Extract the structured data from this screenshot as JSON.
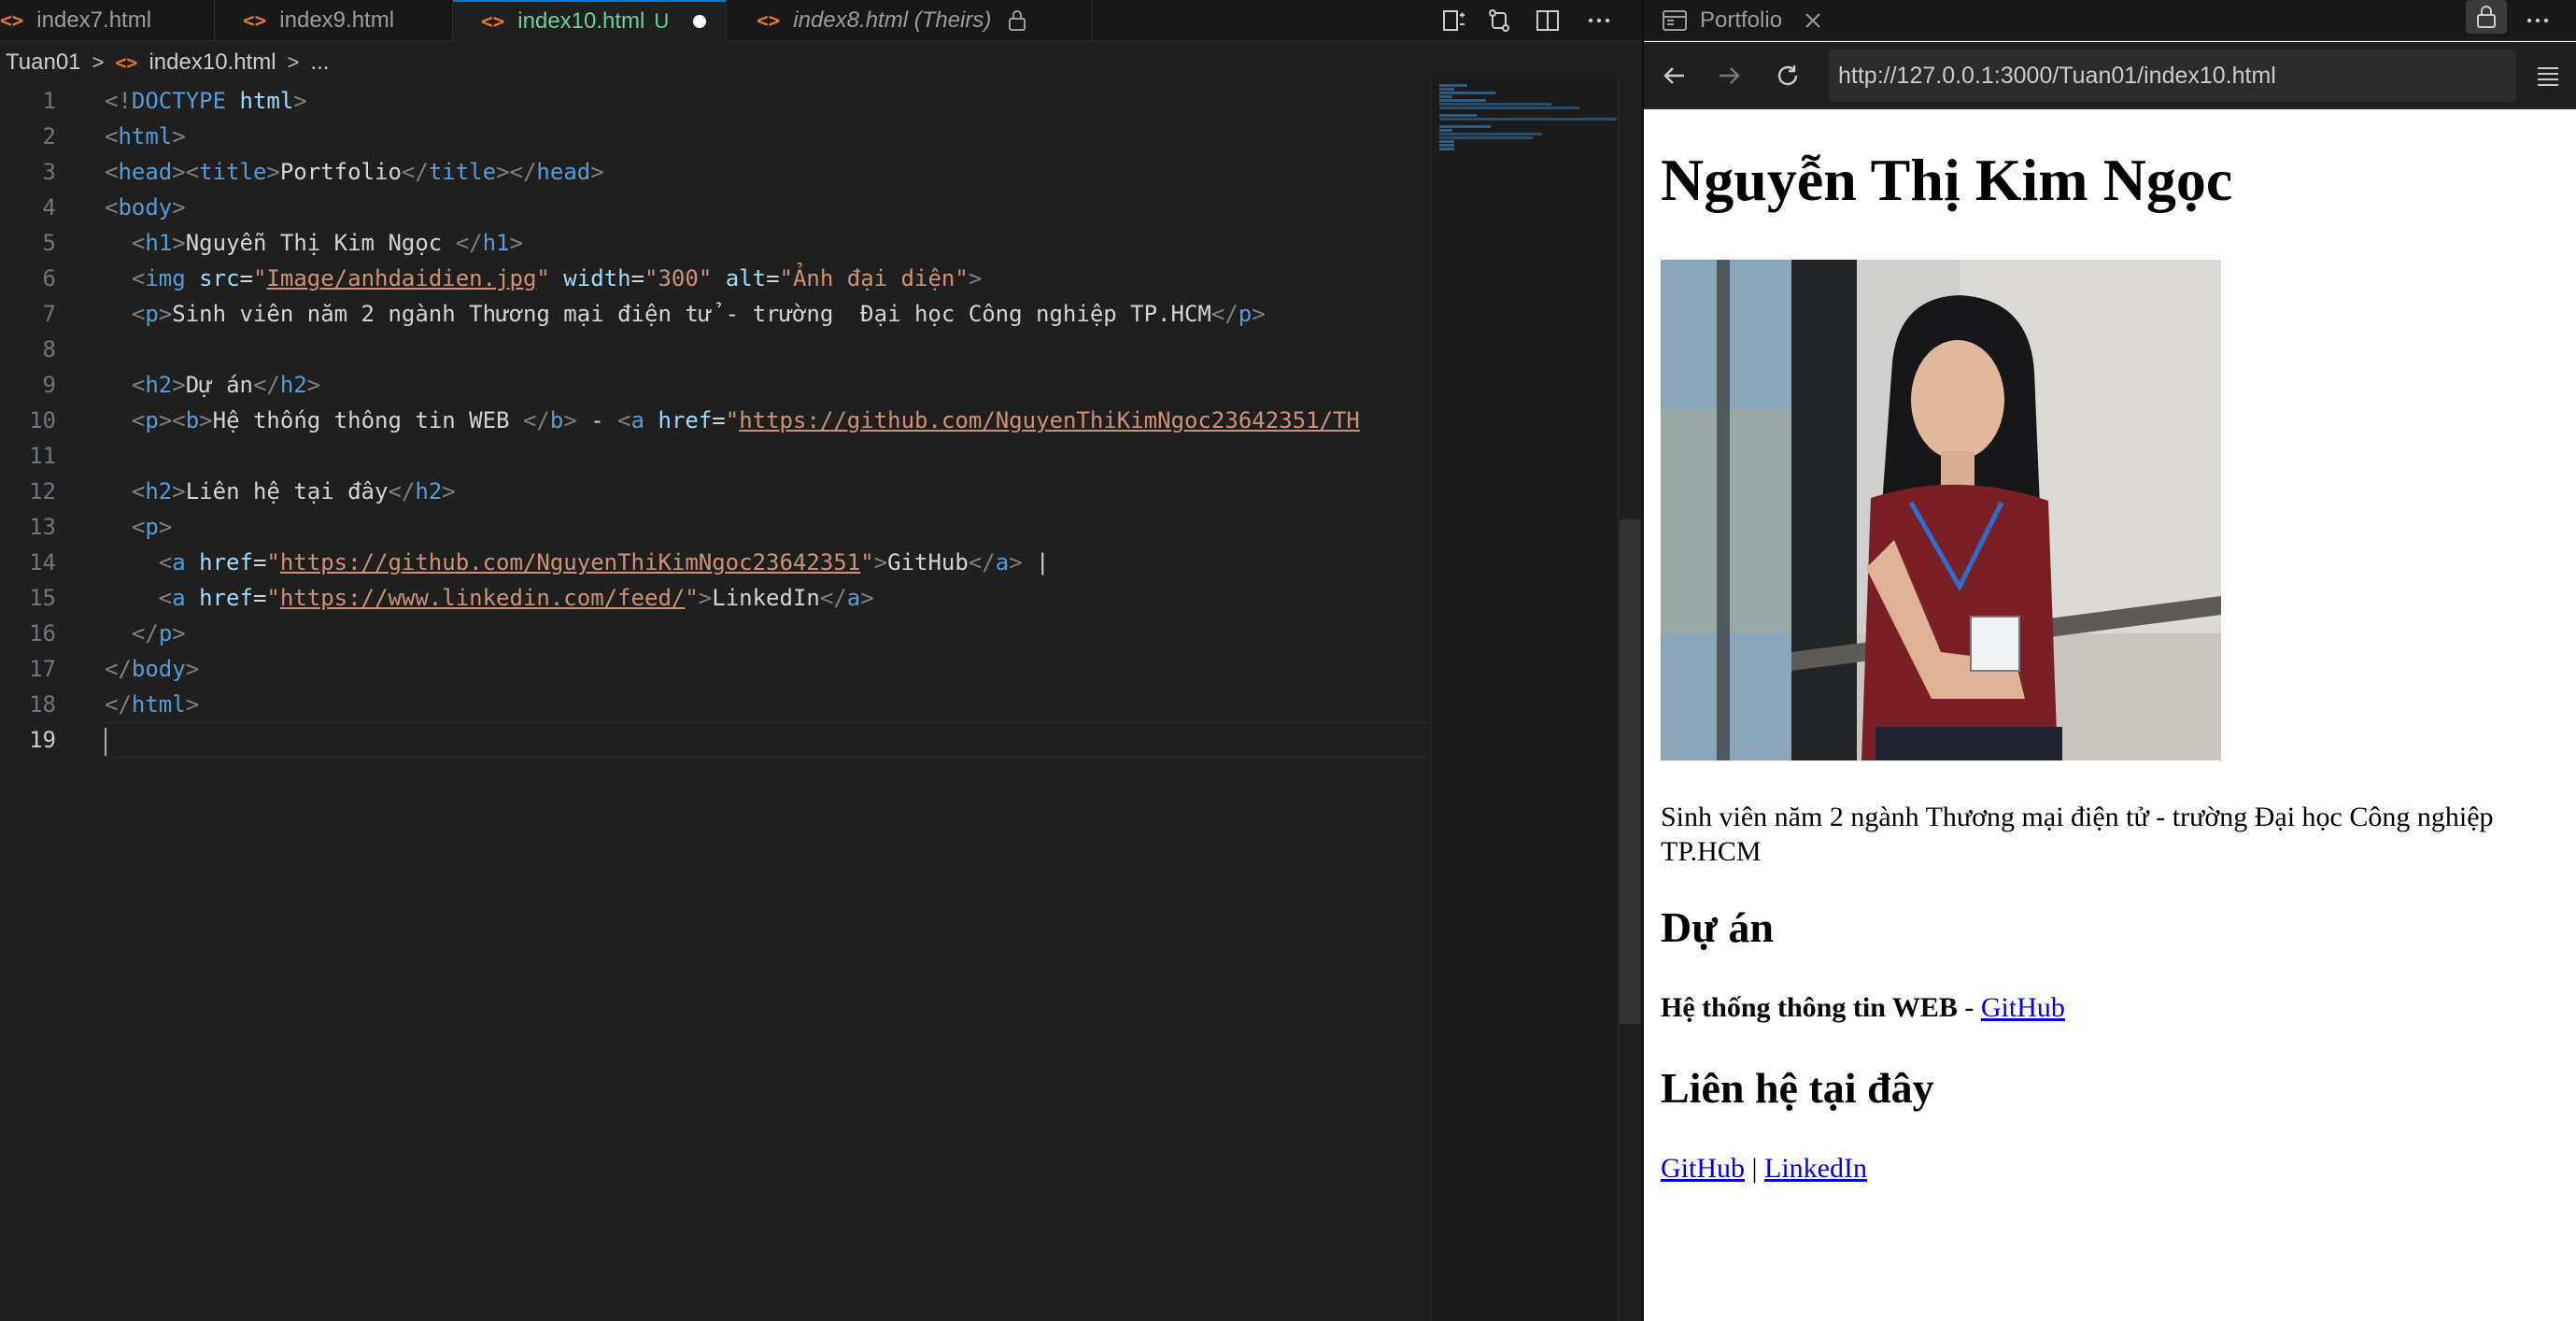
{
  "editor": {
    "tabs": [
      {
        "label": "index7.html"
      },
      {
        "label": "index9.html"
      },
      {
        "label": "index10.html",
        "status": "U"
      },
      {
        "label": "index8.html (Theirs)"
      }
    ],
    "breadcrumb": {
      "folder": "Tuan01",
      "file": "index10.html",
      "more": "..."
    },
    "line_numbers": [
      "1",
      "2",
      "3",
      "4",
      "5",
      "6",
      "7",
      "8",
      "9",
      "10",
      "11",
      "12",
      "13",
      "14",
      "15",
      "16",
      "17",
      "18",
      "19"
    ],
    "current_line": "19",
    "code": {
      "l1": {
        "a": "<!",
        "b": "DOCTYPE",
        "c": " html",
        "d": ">"
      },
      "l2": {
        "a": "<",
        "b": "html",
        "c": ">"
      },
      "l3": {
        "a": "<",
        "b": "head",
        "c": "><",
        "d": "title",
        "e": ">",
        "f": "Portfolio",
        "g": "</",
        "h": "title",
        "i": "></",
        "j": "head",
        "k": ">"
      },
      "l4": {
        "a": "<",
        "b": "body",
        "c": ">"
      },
      "l5": {
        "a": "<",
        "b": "h1",
        "c": ">",
        "d": "Nguyễn Thị Kim Ngọc ",
        "e": "</",
        "f": "h1",
        "g": ">"
      },
      "l6": {
        "a": "<",
        "b": "img",
        "c": " src",
        "d": "=",
        "e": "\"",
        "f": "Image/anhdaidien.jpg",
        "g": "\"",
        "h": " width",
        "i": "=",
        "j": "\"300\"",
        "k": " alt",
        "l": "=",
        "m": "\"Ảnh đại diện\"",
        "n": ">"
      },
      "l7": {
        "a": "<",
        "b": "p",
        "c": ">",
        "d": "Sinh viên năm 2 ngành Thương mại điện tử - trường  Đại học Công nghiệp TP.HCM",
        "e": "</",
        "f": "p",
        "g": ">"
      },
      "l9": {
        "a": "<",
        "b": "h2",
        "c": ">",
        "d": "Dự án",
        "e": "</",
        "f": "h2",
        "g": ">"
      },
      "l10": {
        "a": "<",
        "b": "p",
        "c": "><",
        "d": "b",
        "e": ">",
        "f": "Hệ thống thông tin WEB ",
        "g": "</",
        "h": "b",
        "i": ">",
        "j": " - ",
        "k": "<",
        "l": "a",
        "m": " href",
        "n": "=",
        "o": "\"",
        "p": "https://github.com/NguyenThiKimNgoc23642351/TH"
      },
      "l12": {
        "a": "<",
        "b": "h2",
        "c": ">",
        "d": "Liên hệ tại đây",
        "e": "</",
        "f": "h2",
        "g": ">"
      },
      "l13": {
        "a": "<",
        "b": "p",
        "c": ">"
      },
      "l14": {
        "a": "<",
        "b": "a",
        "c": " href",
        "d": "=",
        "e": "\"",
        "f": "https://github.com/NguyenThiKimNgoc23642351",
        "g": "\"",
        "h": ">",
        "i": "GitHub",
        "j": "</",
        "k": "a",
        "l": ">",
        "m": " |"
      },
      "l15": {
        "a": "<",
        "b": "a",
        "c": " href",
        "d": "=",
        "e": "\"",
        "f": "https://www.linkedin.com/feed/",
        "g": "\"",
        "h": ">",
        "i": "LinkedIn",
        "j": "</",
        "k": "a",
        "l": ">"
      },
      "l16": {
        "a": "</",
        "b": "p",
        "c": ">"
      },
      "l17": {
        "a": "</",
        "b": "body",
        "c": ">"
      },
      "l18": {
        "a": "</",
        "b": "html",
        "c": ">"
      }
    },
    "colors": {
      "tag": "#569cd6",
      "attr": "#9cdcfe",
      "string": "#ce9178",
      "punct": "#808080",
      "active_tab_text": "#6fcf97"
    }
  },
  "browser": {
    "tab_title": "Portfolio",
    "url": "http://127.0.0.1:3000/Tuan01/index10.html",
    "page": {
      "h1": "Nguyễn Thị Kim Ngọc",
      "image_alt": "Ảnh đại diện",
      "intro": "Sinh viên năm 2 ngành Thương mại điện tử - trường Đại học Công nghiệp TP.HCM",
      "projects_heading": "Dự án",
      "project_name": "Hệ thống thông tin WEB",
      "project_sep": " - ",
      "project_link": "GitHub",
      "contact_heading": "Liên hệ tại đây",
      "contact_link1": "GitHub",
      "contact_sep": " | ",
      "contact_link2": "LinkedIn"
    }
  }
}
